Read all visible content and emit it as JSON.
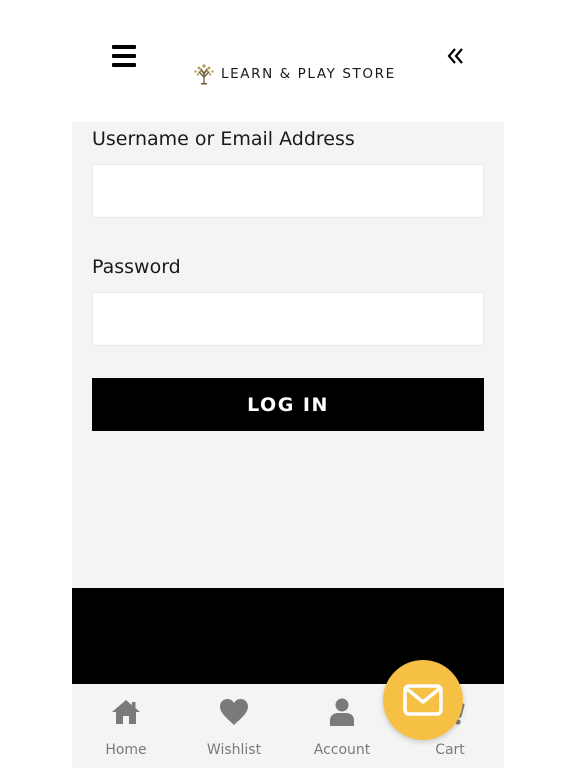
{
  "header": {
    "brand_name": "LEARN & PLAY STORE",
    "menu_icon": "hamburger-menu-icon",
    "collapse_icon": "double-chevron-left-icon"
  },
  "login_form": {
    "username_label": "Username or Email Address",
    "username_value": "",
    "password_label": "Password",
    "password_value": "",
    "submit_label": "LOG IN"
  },
  "bottom_nav": {
    "items": [
      {
        "label": "Home",
        "icon": "home-icon"
      },
      {
        "label": "Wishlist",
        "icon": "heart-icon"
      },
      {
        "label": "Account",
        "icon": "user-icon"
      },
      {
        "label": "Cart",
        "icon": "cart-icon"
      }
    ]
  },
  "fab": {
    "icon": "mail-icon"
  },
  "colors": {
    "accent": "#f6c045",
    "panel_bg": "#f4f4f4",
    "button_bg": "#000000",
    "nav_text": "#7a7a7a",
    "logo_tree": "#b8964f"
  }
}
